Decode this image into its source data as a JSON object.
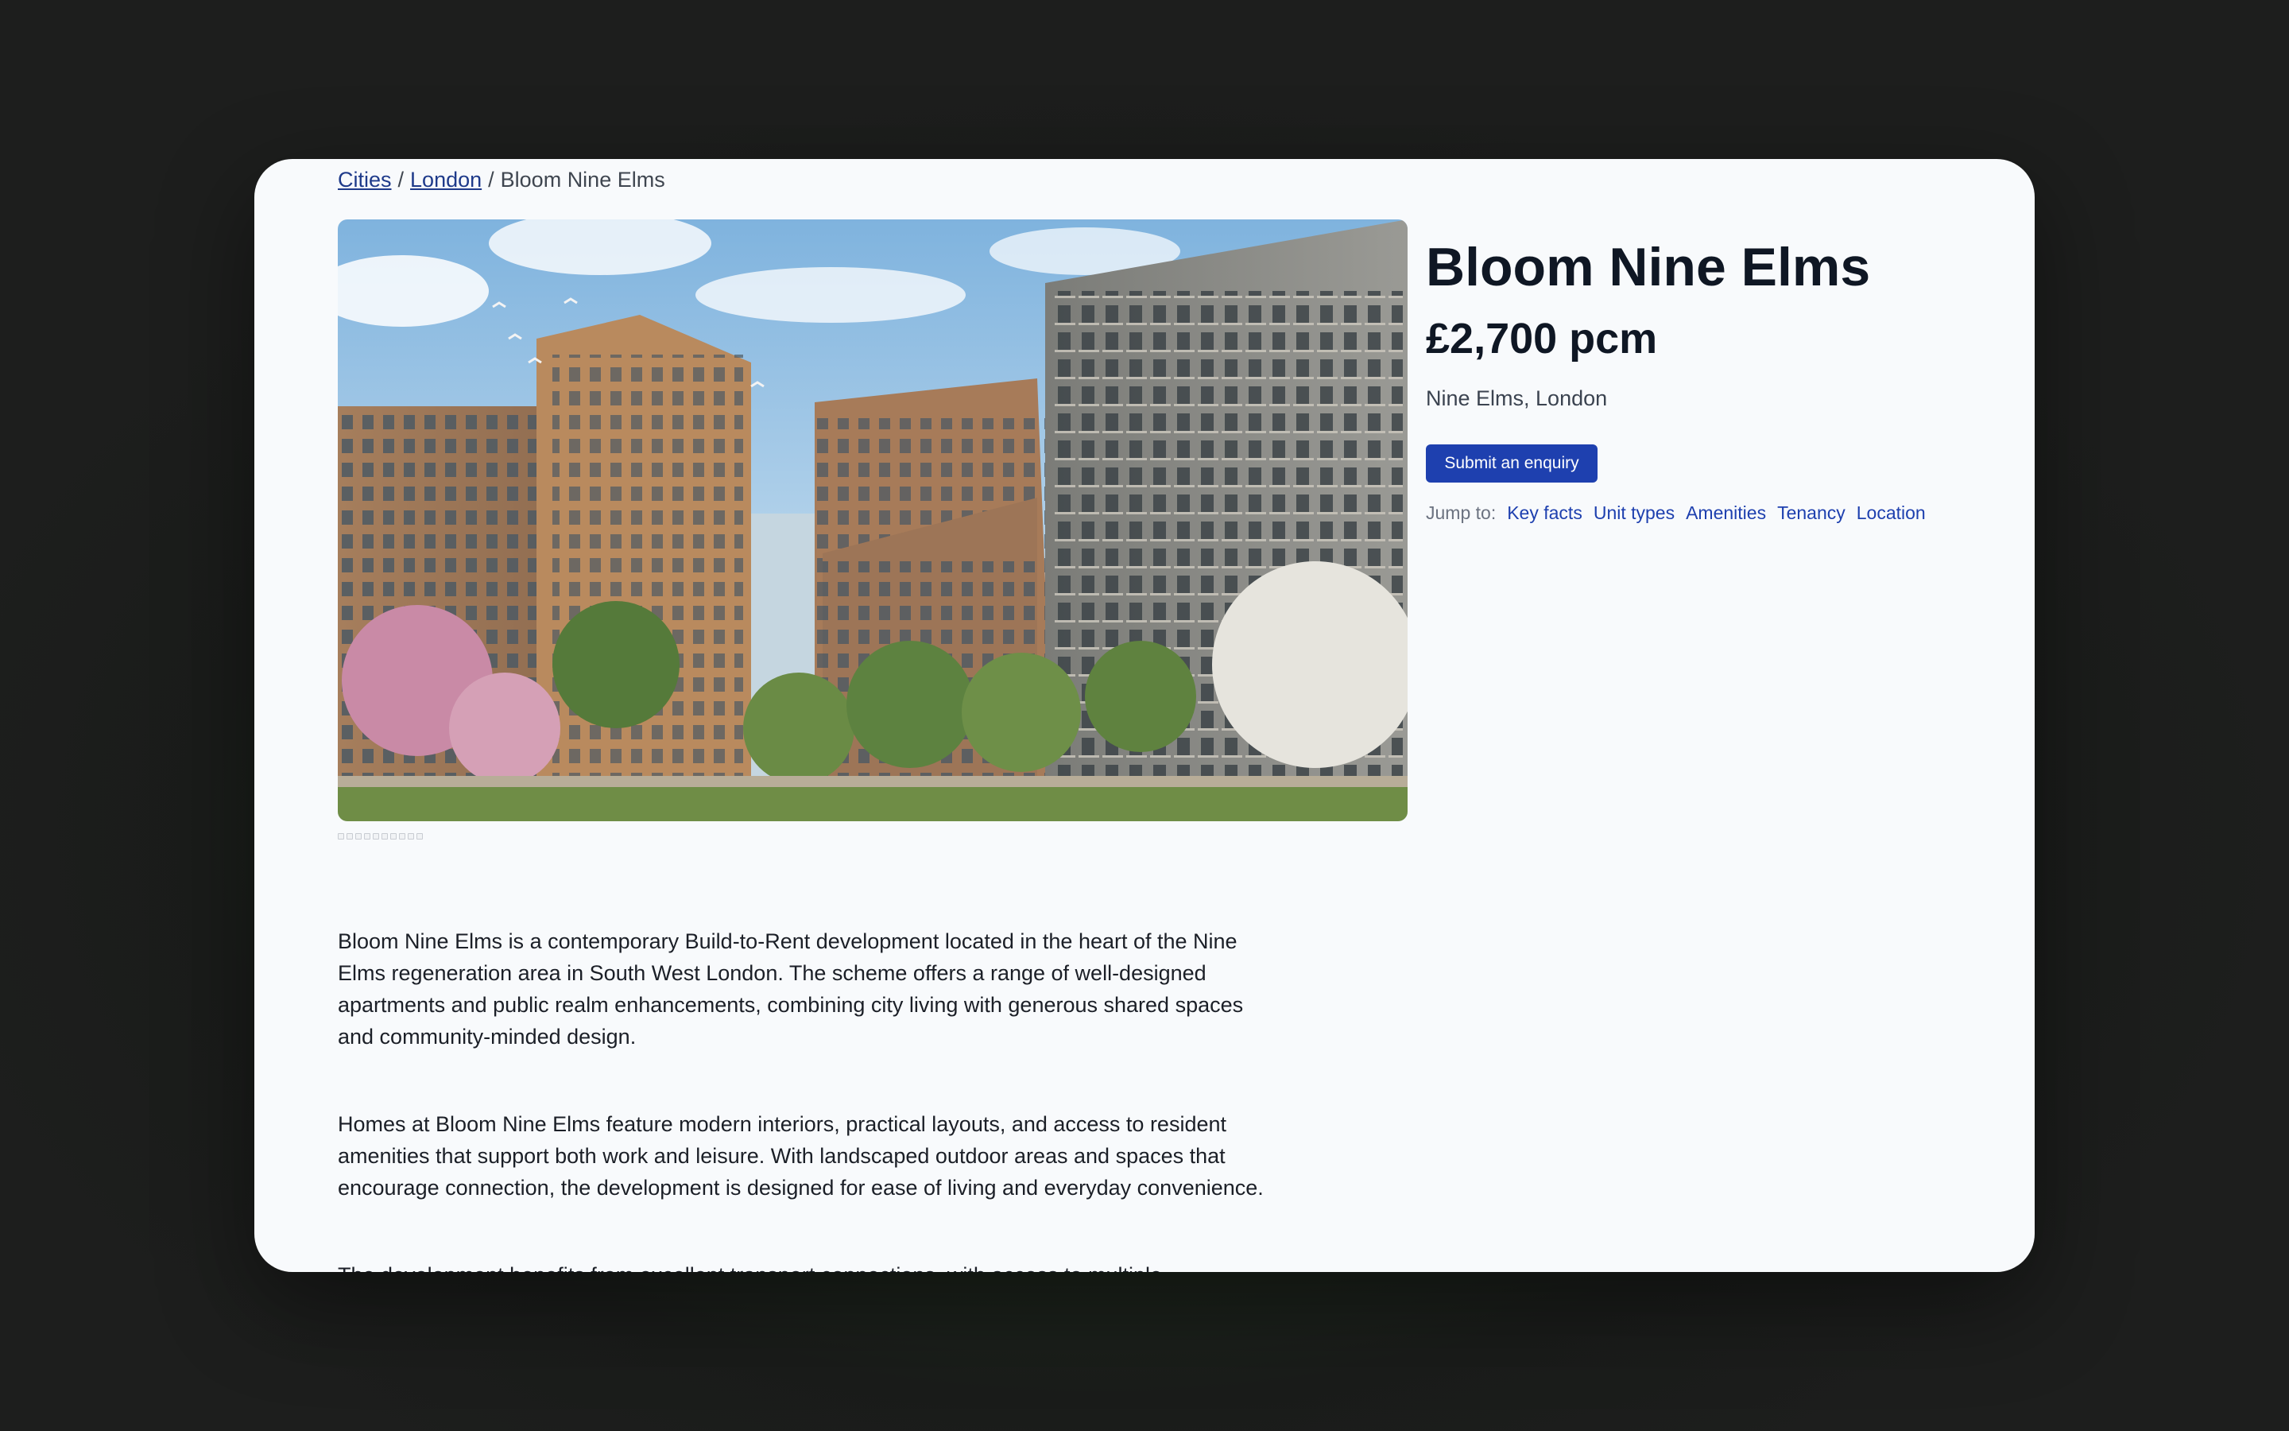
{
  "breadcrumb": {
    "items": [
      "Cities",
      "London"
    ],
    "separator": "/",
    "current": "Bloom Nine Elms"
  },
  "listing": {
    "title": "Bloom Nine Elms",
    "price": "£2,700 pcm",
    "location": "Nine Elms, London",
    "enquiry_label": "Submit an enquiry"
  },
  "jump": {
    "label": "Jump to:",
    "links": [
      "Key facts",
      "Unit types",
      "Amenities",
      "Tenancy",
      "Location"
    ]
  },
  "description": [
    "Bloom Nine Elms is a contemporary Build-to-Rent development located in the heart of the Nine Elms regeneration area in South West London. The scheme offers a range of well-designed apartments and public realm enhancements, combining city living with generous shared spaces and community-minded design.",
    "Homes at Bloom Nine Elms feature modern interiors, practical layouts, and access to resident amenities that support both work and leisure. With landscaped outdoor areas and spaces that encourage connection, the development is designed for ease of living and everyday convenience.",
    "The development benefits from excellent transport connections, with access to multiple"
  ],
  "gallery": {
    "image_count": 10,
    "image_subject": "building-rendering"
  },
  "colors": {
    "accent": "#1e40af",
    "link": "#1e3a8a",
    "text": "#0f1724",
    "page_bg": "#f8fafc"
  }
}
